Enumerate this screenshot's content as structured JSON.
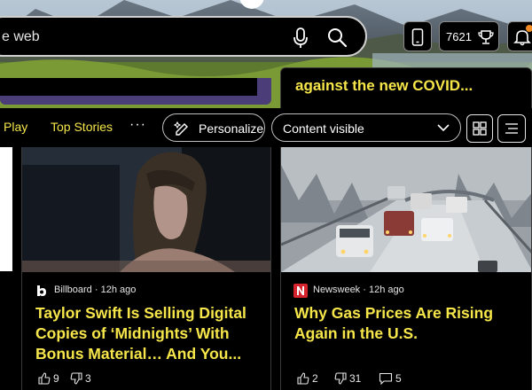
{
  "search": {
    "partial_text": "e web"
  },
  "header": {
    "rewards_points": "7621"
  },
  "behind_cards": {
    "right_title_fragment": "against the new COVID..."
  },
  "nav": {
    "links": [
      "Play",
      "Top Stories"
    ],
    "more_label": "···",
    "personalize_label": "Personalize",
    "content_visibility": {
      "selected": "Content visible"
    }
  },
  "cards": [
    {
      "source": "Billboard",
      "time": "12h ago",
      "headline": "Taylor Swift Is Selling Digital Copies of ‘Midnights’ With Bonus Material… And You...",
      "likes": "9",
      "dislikes": "3"
    },
    {
      "source": "Newsweek",
      "time": "12h ago",
      "headline": "Why Gas Prices Are Rising Again in the U.S.",
      "likes": "2",
      "dislikes": "31",
      "comments": "5"
    }
  ],
  "colors": {
    "headline_accent": "#f6e64a",
    "billboard_logo": "#ffffff",
    "newsweek_logo": "#d5242d",
    "notification_dot": "#f08a24"
  },
  "icons": {
    "search": "magnifier-icon",
    "mic": "microphone-icon",
    "phone": "phone-icon",
    "rewards": "trophy-icon",
    "notifications": "bell-icon",
    "personalize": "sparkle-pen-icon",
    "dropdown": "chevron-down-icon",
    "grid_view": "grid-view-icon",
    "list_view": "list-view-icon",
    "like": "thumbs-up-icon",
    "dislike": "thumbs-down-icon",
    "comment": "comment-icon"
  }
}
